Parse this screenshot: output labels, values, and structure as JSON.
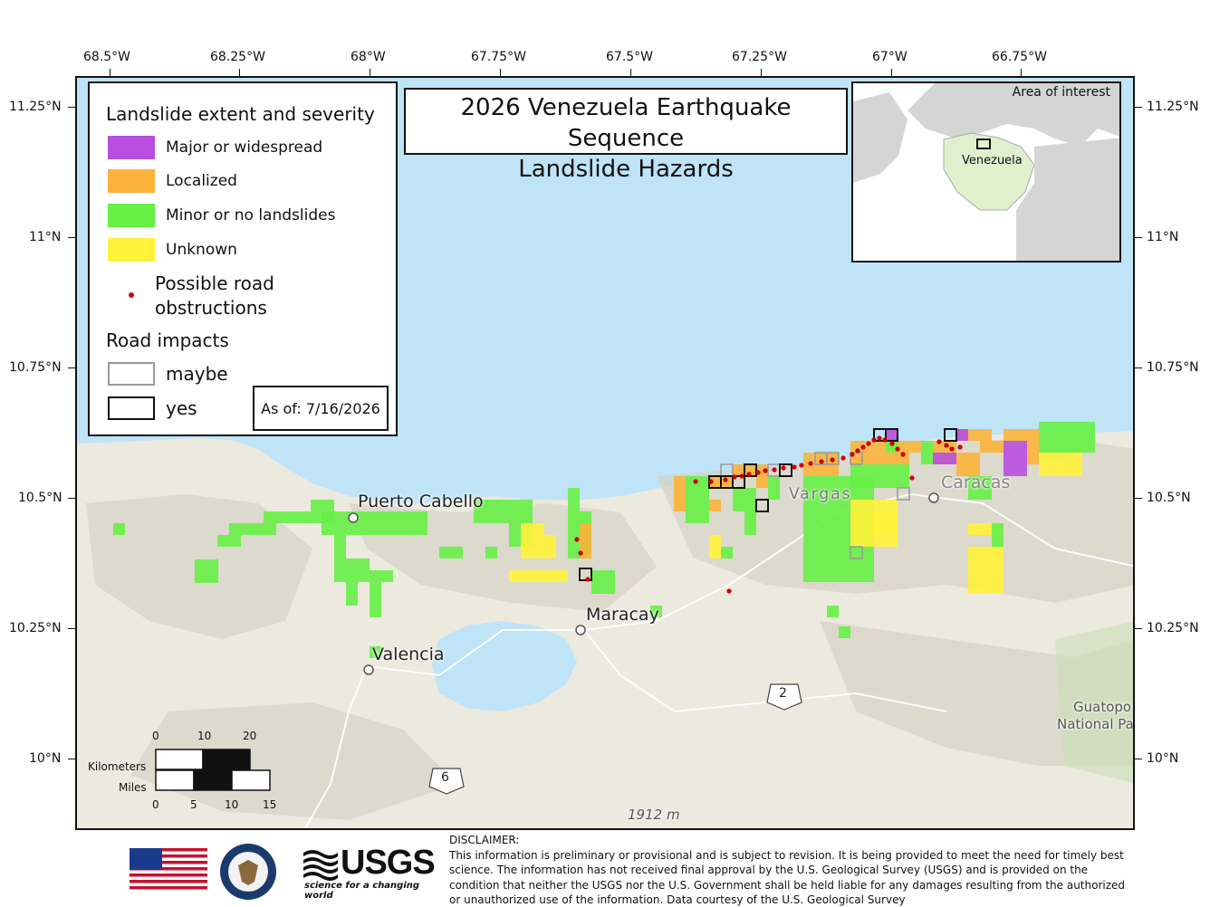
{
  "map": {
    "title_line1": "2026 Venezuela Earthquake Sequence",
    "title_line2": "Landslide Hazards",
    "as_of": "As of: 7/16/2026",
    "longitude_labels": [
      "68.5°W",
      "68.25°W",
      "68°W",
      "67.75°W",
      "67.5°W",
      "67.25°W",
      "67°W",
      "66.75°W"
    ],
    "latitude_labels": [
      "11.25°N",
      "11°N",
      "10.75°N",
      "10.5°N",
      "10.25°N",
      "10°N"
    ]
  },
  "legend": {
    "title": "Landslide extent and severity",
    "items": [
      {
        "label": "Major or widespread",
        "color": "#b84fe0"
      },
      {
        "label": "Localized",
        "color": "#fbb23a"
      },
      {
        "label": "Minor or no landslides",
        "color": "#66f046"
      },
      {
        "label": "Unknown",
        "color": "#fff23a"
      }
    ],
    "road_obstructions_label_1": "Possible road",
    "road_obstructions_label_2": "obstructions",
    "road_impacts_title": "Road impacts",
    "road_maybe": "maybe",
    "road_yes": "yes"
  },
  "inset": {
    "title": "Area of interest",
    "country_label": "Venezuela"
  },
  "places": {
    "puerto_cabello": "Puerto Cabello",
    "maracay": "Maracay",
    "valencia": "Valencia",
    "vargas": "Vargas",
    "caracas": "Caracas",
    "guatopo_1": "Guatopo",
    "guatopo_2": "National Pa",
    "elevation": "1912 m",
    "route_2": "2",
    "route_6": "6"
  },
  "scalebar": {
    "km_label": "Kilometers",
    "mi_label": "Miles",
    "km_ticks": [
      "0",
      "10",
      "20"
    ],
    "mi_ticks": [
      "0",
      "5",
      "10",
      "15"
    ]
  },
  "footer": {
    "usgs": "USGS",
    "usgs_tagline": "science for a changing world",
    "disclaimer_title": "DISCLAIMER:",
    "disclaimer_text": "This information is preliminary or provisional and is subject to revision. It is being provided to meet the need for timely best science. The information has not received final approval by the U.S. Geological Survey (USGS) and is provided on the condition that neither the USGS nor the U.S. Government shall be held liable for any damages resulting from the authorized or unauthorized use of the information. Data courtesy of the U.S. Geological Survey"
  },
  "colors": {
    "sea": "#bfe3f7",
    "land": "#ece9df",
    "major": "#b84fe0",
    "localized": "#fbb23a",
    "minor": "#66f046",
    "unknown": "#fff23a",
    "obstruction": "#cc0000"
  }
}
